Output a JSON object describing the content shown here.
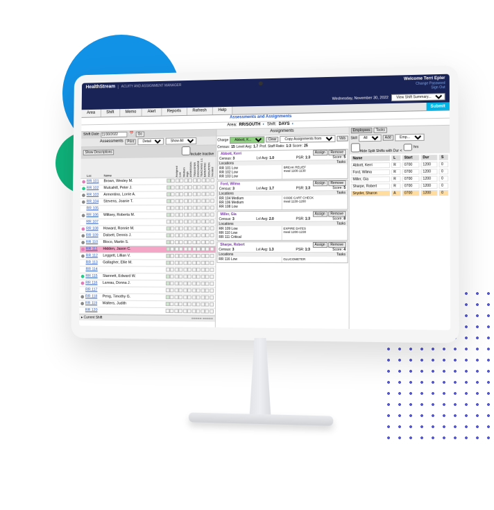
{
  "brand": {
    "name": "HealthStream",
    "subtitle": "ACUITY AND ASSIGNMENT MANAGER"
  },
  "user": {
    "welcome": "Welcome Terri Epler",
    "change_password": "Change Password",
    "sign_out": "Sign Out"
  },
  "date": "Wednesday, November 30, 2022",
  "view_shift_summary": "View Shift Summary...",
  "tabs": {
    "area": "Area",
    "shift": "Shift",
    "memo": "Memo",
    "alert": "Alert",
    "reports": "Reports",
    "refresh": "Refresh",
    "help": "Help"
  },
  "submit_label": "Submit",
  "aa": {
    "title": "Assessments and Assignments",
    "area_label": "Area:",
    "area": "RR/SOUTH",
    "shift_label": "Shift:",
    "shift": "DAYS"
  },
  "shift_bar": {
    "label": "Shift Date",
    "value": "11/30/2022",
    "go": "Go"
  },
  "assessments": {
    "header": "Assessments",
    "print": "Print",
    "detail": "Detail",
    "show_all": "Show All",
    "show_desc": "Show Descriptions",
    "include_inactive": "Include Inactive",
    "loc": "Loc",
    "name": "Name",
    "cats": [
      "Assigned",
      "Low",
      "Medium",
      "High",
      "ADMISSION",
      "TRANSFER",
      "DISCHARGE",
      "TEACHING 1:1",
      "BARIATRIC",
      "ISOLATION",
      "Vacated"
    ]
  },
  "roster": [
    {
      "dot": "#e07ab8",
      "loc": "RR 101",
      "name": "Brown, Wesley M."
    },
    {
      "dot": "#2c8",
      "loc": "RR 102",
      "name": "Mulcahill, Peter J."
    },
    {
      "dot": "#888",
      "loc": "RR 103",
      "name": "Armentino, Lorrie A."
    },
    {
      "dot": "#888",
      "loc": "RR 104",
      "name": "Stevens, Joanie T."
    },
    {
      "dot": "",
      "loc": "RR 105",
      "name": ""
    },
    {
      "dot": "#888",
      "loc": "RR 106",
      "name": "Wiltsey, Roberta M."
    },
    {
      "dot": "",
      "loc": "RR 107",
      "name": ""
    },
    {
      "dot": "#e07ab8",
      "loc": "RR 108",
      "name": "Howard, Ronnie M."
    },
    {
      "dot": "#888",
      "loc": "RR 109",
      "name": "Dalsett, Dennis J."
    },
    {
      "dot": "#888",
      "loc": "RR 110",
      "name": "Bloco, Martin S."
    },
    {
      "dot": "#e07ab8",
      "loc": "RR 111",
      "name": "Hidden, Jason C.",
      "hi": true
    },
    {
      "dot": "#888",
      "loc": "RR 112",
      "name": "Leggett, Lillian V."
    },
    {
      "dot": "",
      "loc": "RR 113",
      "name": "Gallagher, Ellie M."
    },
    {
      "dot": "",
      "loc": "RR 114",
      "name": ""
    },
    {
      "dot": "#2c8",
      "loc": "RR 115",
      "name": "Stannett, Edward W."
    },
    {
      "dot": "#e07ab8",
      "loc": "RR 116",
      "name": "Lareau, Donna J."
    },
    {
      "dot": "",
      "loc": "RR 117",
      "name": ""
    },
    {
      "dot": "#888",
      "loc": "RR 118",
      "name": "Peng, Timothy G."
    },
    {
      "dot": "#888",
      "loc": "RR 119",
      "name": "Walters, Judith"
    },
    {
      "dot": "",
      "loc": "RR 120",
      "name": ""
    }
  ],
  "current_shift_label": "Current Shift",
  "assignments": {
    "header": "Assignments",
    "charge_label": "Charge",
    "charge_value": "Abbott, K...",
    "clear": "Clear",
    "copy": "Copy Assignments from",
    "vals": "Vals",
    "census_label": "Census:",
    "census": "15",
    "level_label": "Level Avg:",
    "level": "1.7",
    "ratio_label": "Prof. Staff Ratio:",
    "ratio": "1:3",
    "score_label": "Score:",
    "score": "25",
    "locations": "Locations",
    "tasks": "Tasks",
    "assign": "Assign",
    "remove": "Remove",
    "psr_label": "PSR:",
    "lvl_label": "Lvl Avg:",
    "cen_label": "Census:",
    "scr_label": "Score:"
  },
  "nurses": [
    {
      "name": "Abbott, Kerri",
      "census": "3",
      "lvl": "1.0",
      "psr": "1:3",
      "score": "5",
      "locs": [
        "RR 101 Low",
        "RR 102 Low",
        "RR 103 Low"
      ],
      "task": "BREAK RELIEF\nmeal 1100-1130"
    },
    {
      "name": "Ford, Wilma",
      "census": "3",
      "lvl": "1.7",
      "psr": "1:3",
      "score": "5",
      "locs": [
        "RR 104 Medium",
        "RR 106 Medium",
        "RR 108 Low"
      ],
      "task": "CODE CART CHECK\nmeal 1130-1200"
    },
    {
      "name": "Miller, Gia",
      "census": "3",
      "lvl": "2.0",
      "psr": "1:3",
      "score": "8",
      "locs": [
        "RR 109 Low",
        "RR 110 Low",
        "RR 111 Critical"
      ],
      "task": "EXPIRE DATES\nmeal 1200-1230"
    },
    {
      "name": "Sharpe, Robert",
      "census": "3",
      "lvl": "1.3",
      "psr": "1:3",
      "score": "4",
      "locs": [
        "RR 116 Low"
      ],
      "task": "GLUCOMETER"
    }
  ],
  "employees": {
    "tab_emp": "Employees",
    "tab_tasks": "Tasks",
    "skill": "Skill",
    "all": "All",
    "add": "Add",
    "emp": "Emp...",
    "hide": "Hide Split Shifts with Dur <",
    "hrs": "hrs",
    "cols": {
      "name": "Name",
      "l": "L",
      "start": "Start",
      "dur": "Dur",
      "s": "S"
    },
    "rows": [
      {
        "name": "Abbott, Kerri",
        "l": "R",
        "start": "0700",
        "dur": "1200",
        "s": "0"
      },
      {
        "name": "Ford, Wilma",
        "l": "R",
        "start": "0700",
        "dur": "1200",
        "s": "0"
      },
      {
        "name": "Miller, Gia",
        "l": "R",
        "start": "0700",
        "dur": "1200",
        "s": "0"
      },
      {
        "name": "Sharpe, Robert",
        "l": "R",
        "start": "0700",
        "dur": "1200",
        "s": "0"
      },
      {
        "name": "Snyder, Sharon",
        "l": "A",
        "start": "0700",
        "dur": "1200",
        "s": "0",
        "sel": true
      }
    ]
  }
}
